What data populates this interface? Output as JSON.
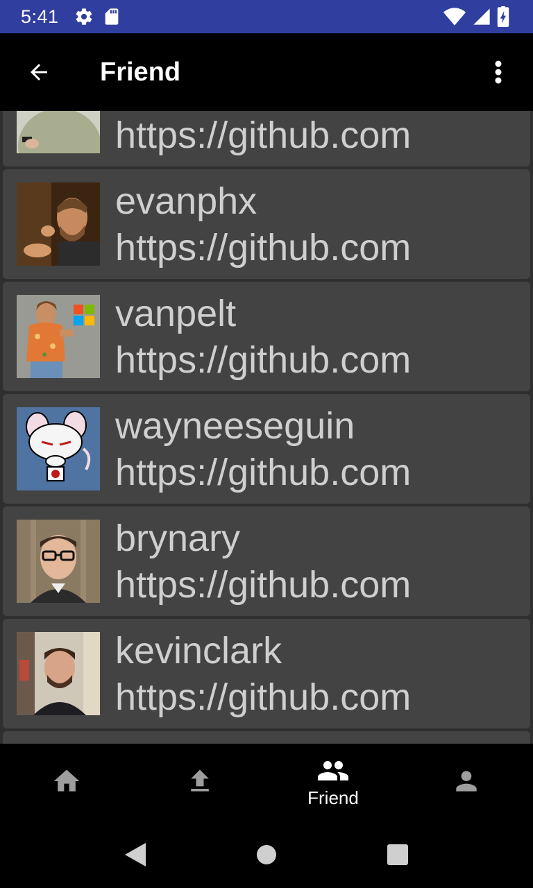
{
  "status_bar": {
    "time": "5:41",
    "icons": [
      "settings-icon",
      "sd-card-icon",
      "wifi-icon",
      "cell-signal-icon",
      "battery-icon"
    ],
    "background": "#303f9f"
  },
  "app_bar": {
    "title": "Friend",
    "back_icon": "arrow-back-icon",
    "menu_icon": "more-vert-icon"
  },
  "friends": [
    {
      "name": "",
      "url": "https://github.com",
      "avatar": "avatar-partial"
    },
    {
      "name": "evanphx",
      "url": "https://github.com",
      "avatar": "avatar-evanphx"
    },
    {
      "name": "vanpelt",
      "url": "https://github.com",
      "avatar": "avatar-vanpelt"
    },
    {
      "name": "wayneeseguin",
      "url": "https://github.com",
      "avatar": "avatar-wayneeseguin"
    },
    {
      "name": "brynary",
      "url": "https://github.com",
      "avatar": "avatar-brynary"
    },
    {
      "name": "kevinclark",
      "url": "https://github.com",
      "avatar": "avatar-kevinclark"
    }
  ],
  "bottom_nav": {
    "items": [
      {
        "icon": "home-icon",
        "label": "",
        "active": false
      },
      {
        "icon": "upload-icon",
        "label": "",
        "active": false
      },
      {
        "icon": "people-icon",
        "label": "Friend",
        "active": true
      },
      {
        "icon": "person-icon",
        "label": "",
        "active": false
      }
    ],
    "active_color": "#ffffff",
    "inactive_color": "#9e9e9e"
  },
  "system_nav": [
    "back-triangle-icon",
    "home-circle-icon",
    "recents-square-icon"
  ]
}
